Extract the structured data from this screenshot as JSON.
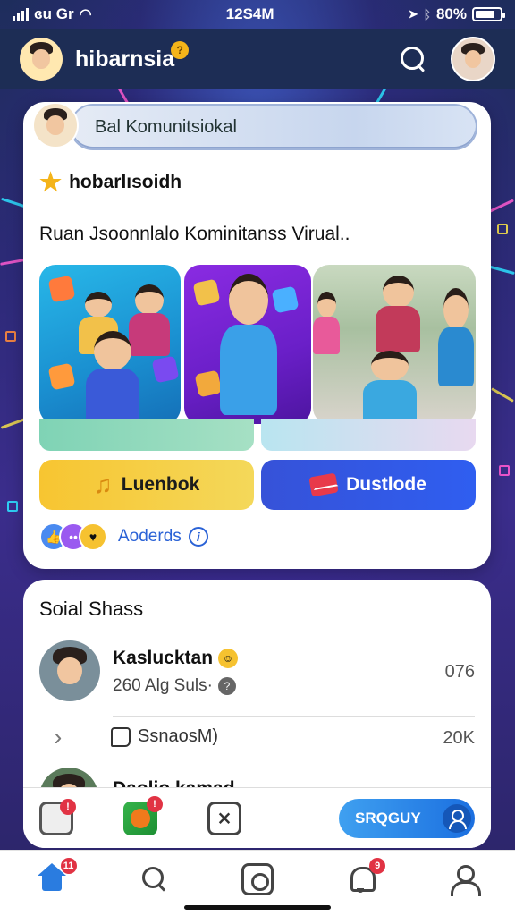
{
  "status_bar": {
    "carrier": "ɞu Gr",
    "time": "12S4M",
    "battery": "80%",
    "battery_level": 0.8
  },
  "header": {
    "brand": "hibarnsia",
    "brand_badge": "?"
  },
  "composer": {
    "placeholder": "Bal Komunitsiokal"
  },
  "post": {
    "title": "hobarlısoidh",
    "description": "Ruan Jsoonnlalo Kominitanss Virual..",
    "button_primary": "Luenbok",
    "button_secondary": "Dustlode",
    "reactions_label": "Aoderds",
    "info_glyph": "i"
  },
  "social": {
    "section_title": "Soial Shass",
    "item": {
      "name": "Kaslucktan",
      "subtitle": "260 Alg Suls·",
      "count": "076"
    },
    "like_label": "SsnaosM)",
    "like_count": "20K",
    "peek_name": "Daolio kamad"
  },
  "action_bar": {
    "badge1": "!",
    "badge2": "!",
    "cta": "SRQGUY",
    "icon3_glyph": "⨯"
  },
  "nav": {
    "home_badge": "11",
    "bell_badge": "9"
  },
  "colors": {
    "accent_blue": "#2a7ce0",
    "button_yellow": "#f7c531",
    "button_blue": "#3652d8",
    "header_bg": "#1d2d55"
  }
}
